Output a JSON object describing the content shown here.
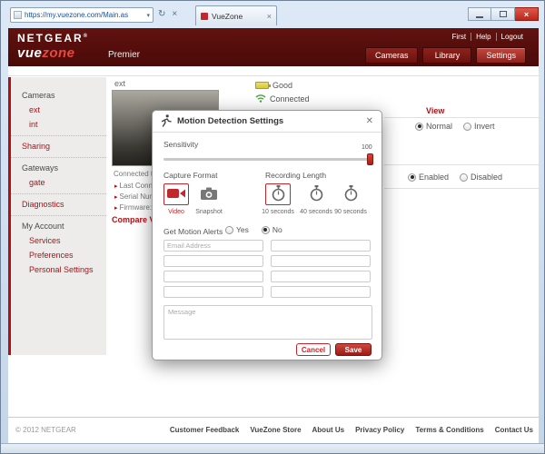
{
  "colors": {
    "accent_red": "#c1272d",
    "header_maroon": "#4a0a08",
    "sidebar_bg": "#edecea",
    "status_green": "#4aa33f",
    "battery_yellow": "#d8c83a"
  },
  "browser": {
    "url": "https://my.vuezone.com/Main.as",
    "tab_title": "VueZone"
  },
  "header": {
    "brand": "NETGEAR",
    "registered": "®",
    "logo_vue": "vue",
    "logo_zone": "zone",
    "edition": "Premier",
    "user_links": [
      {
        "label": "First"
      },
      {
        "label": "Help"
      },
      {
        "label": "Logout"
      }
    ],
    "nav": [
      {
        "label": "Cameras",
        "active": false
      },
      {
        "label": "Library",
        "active": false
      },
      {
        "label": "Settings",
        "active": true
      }
    ]
  },
  "sidebar": {
    "items": [
      {
        "label": "Cameras"
      },
      {
        "label": "ext"
      },
      {
        "label": "int"
      },
      {
        "label": "Sharing"
      },
      {
        "label": "Gateways"
      },
      {
        "label": "gate"
      },
      {
        "label": "Diagnostics"
      },
      {
        "label": "My Account"
      },
      {
        "label": "Services"
      },
      {
        "label": "Preferences"
      },
      {
        "label": "Personal Settings"
      }
    ]
  },
  "content": {
    "camera_title": "ext",
    "battery_status": "Good",
    "connection_status": "Connected",
    "thumb_caption": "Connected t...",
    "detail_lines": [
      {
        "text": "Last Connect..."
      },
      {
        "text": "Serial Numb..."
      },
      {
        "text": "Firmware: 02..."
      }
    ],
    "compare_link": "Compare Vue...",
    "view_label": "View",
    "view_options": [
      {
        "label": "Normal",
        "selected": true
      },
      {
        "label": "Invert",
        "selected": false
      }
    ],
    "state_options": [
      {
        "label": "Enabled",
        "selected": true
      },
      {
        "label": "Disabled",
        "selected": false
      }
    ]
  },
  "modal": {
    "title": "Motion Detection Settings",
    "sensitivity_label": "Sensitivity",
    "sensitivity_value": "100",
    "capture_format_label": "Capture Format",
    "capture_options": [
      {
        "label": "Video",
        "selected": true
      },
      {
        "label": "Snapshot",
        "selected": false
      }
    ],
    "recording_length_label": "Recording Length",
    "recording_options": [
      {
        "label": "10 seconds",
        "selected": true
      },
      {
        "label": "40 seconds",
        "selected": false
      },
      {
        "label": "90 seconds",
        "selected": false
      }
    ],
    "alerts_label": "Get Motion Alerts",
    "alerts_options": [
      {
        "label": "Yes",
        "selected": false
      },
      {
        "label": "No",
        "selected": true
      }
    ],
    "email_placeholder": "Email Address",
    "message_placeholder": "Message",
    "cancel_label": "Cancel",
    "save_label": "Save"
  },
  "footer": {
    "copyright": "© 2012 NETGEAR",
    "links": [
      {
        "label": "Customer Feedback"
      },
      {
        "label": "VueZone Store"
      },
      {
        "label": "About Us"
      },
      {
        "label": "Privacy Policy"
      },
      {
        "label": "Terms & Conditions"
      },
      {
        "label": "Contact Us"
      }
    ]
  }
}
